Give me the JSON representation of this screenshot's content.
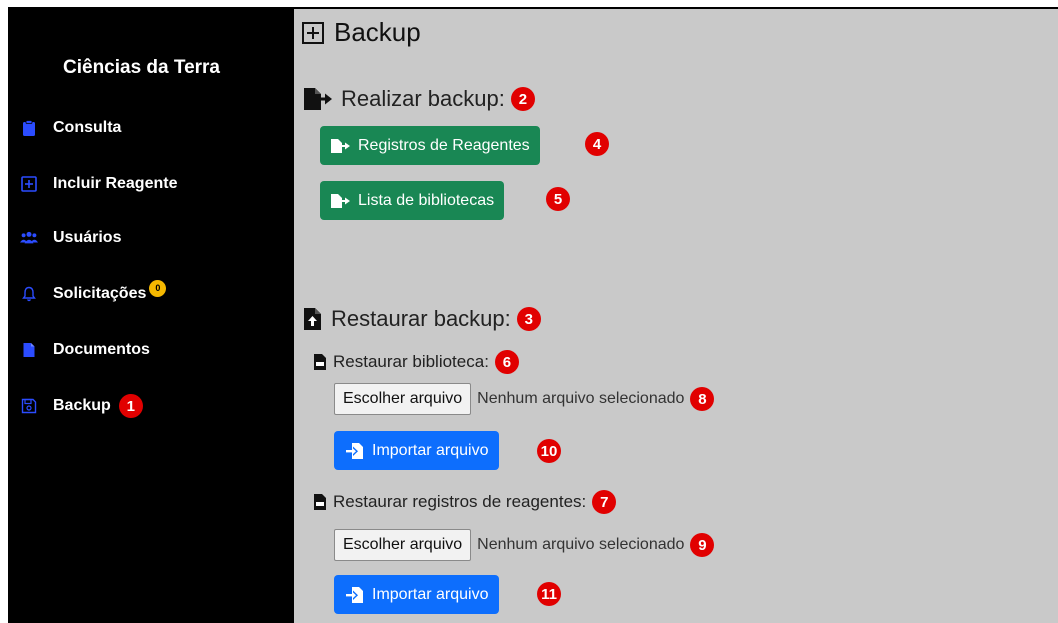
{
  "sidebar": {
    "brand": "Ciências da Terra",
    "items": [
      {
        "label": "Consulta",
        "icon": "clipboard-icon"
      },
      {
        "label": "Incluir Reagente",
        "icon": "plus-square-icon"
      },
      {
        "label": "Usuários",
        "icon": "users-icon"
      },
      {
        "label": "Solicitações",
        "icon": "bell-icon",
        "badge": "0"
      },
      {
        "label": "Documentos",
        "icon": "file-icon"
      },
      {
        "label": "Backup",
        "icon": "floppy-disk-icon",
        "marker": "1"
      }
    ]
  },
  "main": {
    "title": "Backup",
    "realizar": {
      "heading": "Realizar backup:",
      "marker": "2",
      "buttons": [
        {
          "label": "Registros de Reagentes",
          "marker": "4"
        },
        {
          "label": "Lista de bibliotecas",
          "marker": "5"
        }
      ]
    },
    "restaurar": {
      "heading": "Restaurar backup:",
      "marker": "3",
      "groups": [
        {
          "label": "Restaurar biblioteca:",
          "marker": "6",
          "file_button": "Escolher arquivo",
          "file_status": "Nenhum arquivo selecionado",
          "file_marker": "8",
          "import_label": "Importar arquivo",
          "import_marker": "10"
        },
        {
          "label": "Restaurar registros de reagentes:",
          "marker": "7",
          "file_button": "Escolher arquivo",
          "file_status": "Nenhum arquivo selecionado",
          "file_marker": "9",
          "import_label": "Importar arquivo",
          "import_marker": "11"
        }
      ]
    }
  },
  "colors": {
    "sidebar_bg": "#000000",
    "icon_blue": "#2b4cff",
    "marker_red": "#e10000",
    "badge_yellow": "#f5b800",
    "button_green": "#198754",
    "button_blue": "#0d6efd",
    "content_bg": "#c9c9c9"
  }
}
